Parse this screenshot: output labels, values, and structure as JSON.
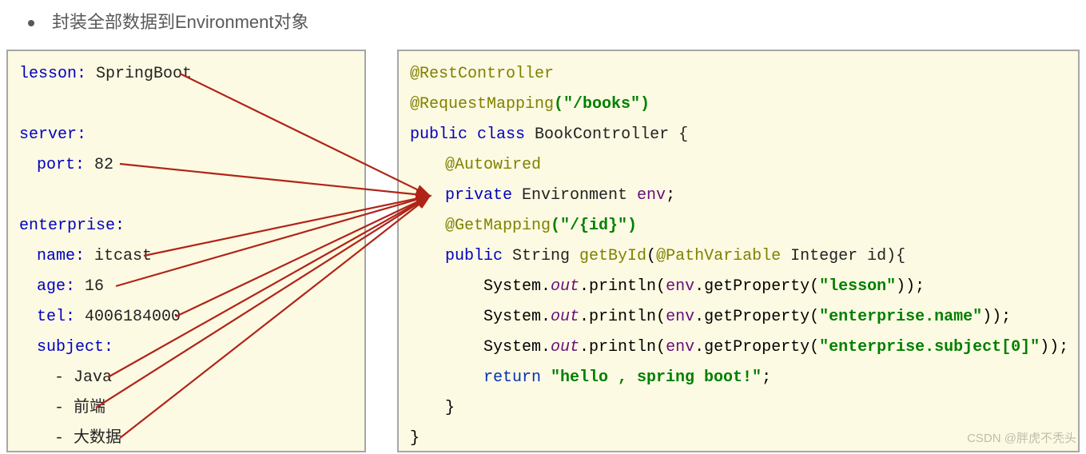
{
  "heading": "封装全部数据到Environment对象",
  "yaml": {
    "lesson_key": "lesson:",
    "lesson_val": " SpringBoot",
    "server_key": "server:",
    "port_key": "port:",
    "port_val": " 82",
    "enterprise_key": "enterprise:",
    "name_key": "name:",
    "name_val": " itcast",
    "age_key": "age:",
    "age_val": " 16",
    "tel_key": "tel:",
    "tel_val": " 4006184000",
    "subject_key": "subject:",
    "subj_java": "- Java",
    "subj_fe": "- 前端",
    "subj_bd": "- 大数据"
  },
  "java": {
    "ann_rc": "@RestController",
    "ann_rm": "@RequestMapping",
    "rm_arg": "(\"/books\")",
    "public": "public",
    "class": "class",
    "classname": " BookController {",
    "ann_aw": "@Autowired",
    "private": "private",
    "envtype": " Environment ",
    "envvar": "env",
    "semi": ";",
    "ann_gm": "@GetMapping",
    "gm_arg": "(\"/{id}\")",
    "string": " String ",
    "getbyid": "getById",
    "openp": "(",
    "ann_pv": "@PathVariable",
    "intid": " Integer id){",
    "sys": "System.",
    "out": "out",
    "println": ".println(",
    "env": "env",
    "getprop": ".getProperty(",
    "arg_lesson": "\"lesson\"",
    "arg_name": "\"enterprise.name\"",
    "arg_subj": "\"enterprise.subject[0]\"",
    "close2": "));",
    "return": "return",
    "retstr": " \"hello , spring boot!\"",
    "closebrace1": "}",
    "closebrace2": "}"
  },
  "watermark": "CSDN @胖虎不秃头"
}
